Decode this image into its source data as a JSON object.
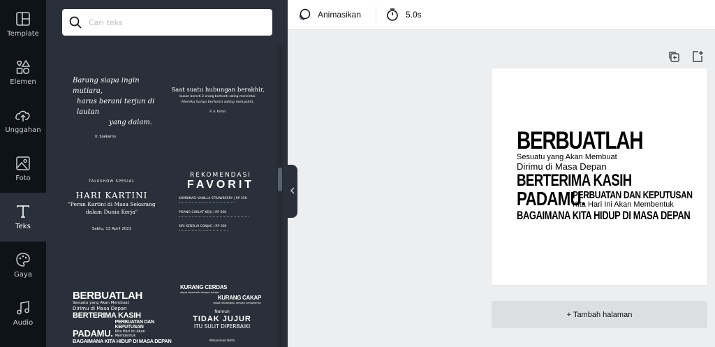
{
  "nav": {
    "items": [
      {
        "label": "Template",
        "icon": "template-icon"
      },
      {
        "label": "Elemen",
        "icon": "elements-icon"
      },
      {
        "label": "Unggahan",
        "icon": "upload-icon"
      },
      {
        "label": "Foto",
        "icon": "photo-icon"
      },
      {
        "label": "Teks",
        "icon": "text-icon"
      },
      {
        "label": "Gaya",
        "icon": "palette-icon"
      },
      {
        "label": "Audio",
        "icon": "music-icon"
      }
    ],
    "active": "Teks"
  },
  "panel": {
    "search_placeholder": "Cari teks",
    "templates": {
      "t1": {
        "line1": "Barang siapa ingin mutiara,",
        "line2": "harus berani terjun di lautan",
        "line3": "yang dalam.",
        "author": "Ir. Soekarno"
      },
      "t2": {
        "line1": "Saat suatu hubungan berakhir,",
        "line2": "bukan berarti 2 orang berhenti saling mencintai.",
        "line3": "Mereka hanya berhenti saling menyakiti.",
        "author": "R. A. Kartini"
      },
      "t3": {
        "kicker": "TALKSHOW SPESIAL",
        "title": "HARI KARTINI",
        "line1": "\"Peran Kartini di Masa Sekarang",
        "line2": "dalam Dunia Kerja\"",
        "date": "Sabtu, 13 April 2021"
      },
      "t4": {
        "kicker": "REKOMENDASI",
        "title": "FAVORIT",
        "item1": "KOMBINASI VANILLA STRAWBERRY | RP 35K",
        "item2": "PISANG COKLAT KEJU | RP 50K",
        "item3": "SIRI KEDELAI CONJAC | RP 30K"
      },
      "t5": {
        "l1": "BERBUATLAH",
        "l2": "Sesuatu yang Akan Membuat",
        "l3": "Dirimu di Masa Depan",
        "l4": "BERTERIMA KASIH",
        "l5": "PADAMU.",
        "l6": "PERBUATAN DAN KEPUTUSAN",
        "l7": "Kita Hari Ini Akan Membentuk",
        "l8": "BAGAIMANA KITA HIDUP DI MASA DEPAN"
      },
      "t6": {
        "l1": "KURANG CERDAS",
        "l2": "dapat diperbaiki dengan belajar",
        "l3": "KURANG CAKAP",
        "l4": "dapat dihilangkan dengan pengalaman",
        "l5": "Namun",
        "l6": "TIDAK JUJUR",
        "l7": "ITU SULIT DIPERBAIKI",
        "l8": "Mohammad Hatta"
      }
    }
  },
  "toolbar": {
    "animate_label": "Animasikan",
    "duration_label": "5.0s"
  },
  "canvas": {
    "design": {
      "l1": "BERBUATLAH",
      "l2": "Sesuatu yang Akan Membuat",
      "l3": "Dirimu di Masa Depan",
      "l4": "BERTERIMA KASIH",
      "l5": "PADAMU.",
      "l6": "PERBUATAN DAN KEPUTUSAN",
      "l7": "Kita Hari Ini Akan Membentuk",
      "l8": "BAGAIMANA KITA HIDUP DI MASA DEPAN"
    },
    "add_page_label": "+ Tambah halaman"
  }
}
